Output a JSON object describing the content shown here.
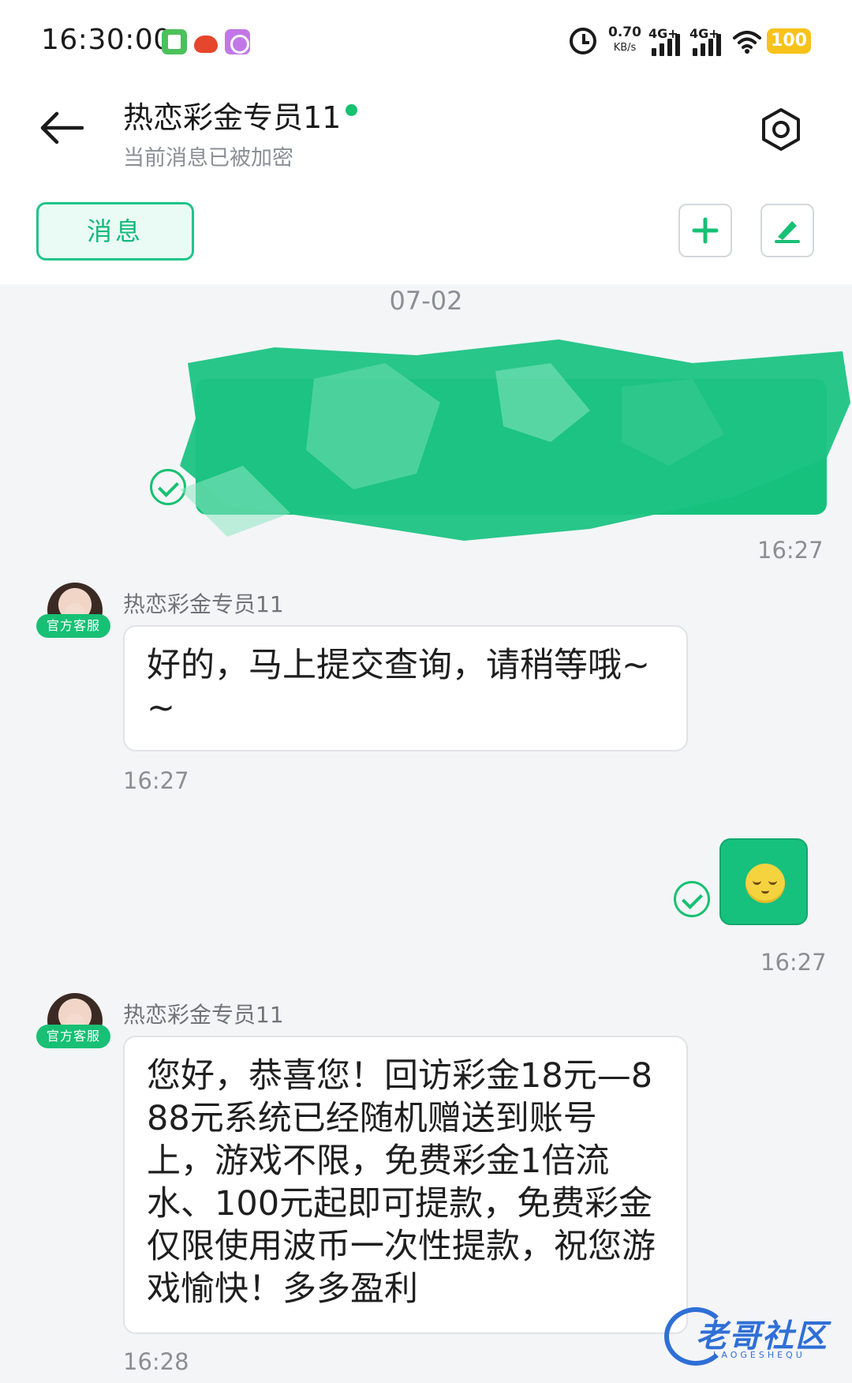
{
  "status_bar": {
    "time": "16:30:00",
    "net_speed_value": "0.70",
    "net_speed_unit": "KB/s",
    "signal1_label": "4G+",
    "signal2_label": "4G+",
    "battery": "100",
    "icons": [
      "notes-app-icon",
      "red-app-icon",
      "purple-app-icon",
      "alarm-icon",
      "wifi-icon"
    ]
  },
  "header": {
    "title": "热恋彩金专员11",
    "subtitle": "当前消息已被加密",
    "online_color": "#16c171"
  },
  "tabs": {
    "message_label": "消息"
  },
  "chat": {
    "date": "07-02",
    "messages": [
      {
        "direction": "out",
        "type": "redacted",
        "time": "16:27"
      },
      {
        "direction": "in",
        "sender": "热恋彩金专员11",
        "badge": "官方客服",
        "text": "好的，马上提交查询，请稍等哦~~",
        "time": "16:27"
      },
      {
        "direction": "out",
        "type": "emoji",
        "emoji": "relieved-face",
        "time": "16:27"
      },
      {
        "direction": "in",
        "sender": "热恋彩金专员11",
        "badge": "官方客服",
        "text": "您好，恭喜您！回访彩金18元—888元系统已经随机赠送到账号上，游戏不限，免费彩金1倍流水、100元起即可提款，免费彩金仅限使用波币一次性提款，祝您游戏愉快！多多盈利",
        "time": "16:28"
      }
    ]
  },
  "watermark": {
    "text": "老哥社区",
    "sub": "LAOGESHEQU"
  },
  "colors": {
    "accent": "#16c17d",
    "bubble_in": "#ffffff",
    "background": "#f4f5f7"
  }
}
